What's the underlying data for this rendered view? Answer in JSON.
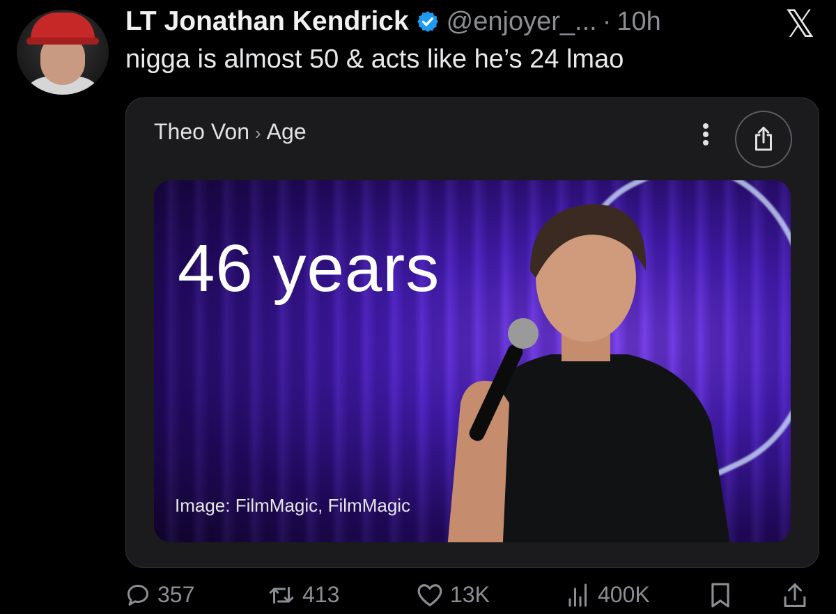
{
  "author": {
    "name": "LT Jonathan Kendrick",
    "handle": "@enjoyer_...",
    "separator": "·",
    "time": "10h"
  },
  "platform_icon": "x-logo",
  "tweet_text": "nigga is almost 50 & acts like he’s 24 lmao",
  "card": {
    "breadcrumb_subject": "Theo Von",
    "breadcrumb_separator": "›",
    "breadcrumb_attribute": "Age",
    "answer": "46 years",
    "image_credit": "Image: FilmMagic, FilmMagic",
    "icons": [
      "more-vertical-icon",
      "share-icon"
    ]
  },
  "actions": {
    "replies": "357",
    "reposts": "413",
    "likes": "13K",
    "views": "400K",
    "icons": [
      "reply-icon",
      "repost-icon",
      "like-icon",
      "views-icon",
      "bookmark-icon",
      "share-icon"
    ]
  },
  "colors": {
    "background": "#000000",
    "muted": "#8b8f93",
    "verified": "#1d9bf0",
    "card": "#1b1b1d"
  }
}
